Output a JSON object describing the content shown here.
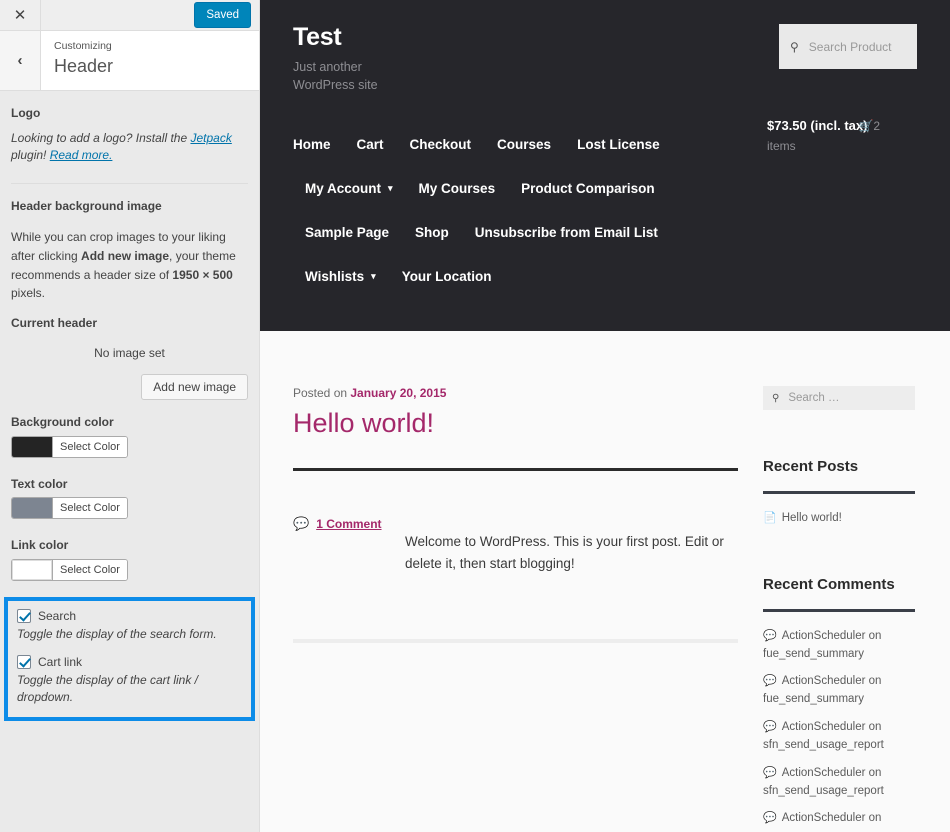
{
  "customizer": {
    "close_icon": "close-icon",
    "save_label": "Saved",
    "back_icon": "chevron-left-icon",
    "eyebrow": "Customizing",
    "title": "Header",
    "logo": {
      "label": "Logo",
      "desc_part1": "Looking to add a logo? Install the ",
      "link1": "Jetpack",
      "desc_part2": " plugin! ",
      "link2": "Read more."
    },
    "header_image": {
      "label": "Header background image",
      "desc_1": "While you can crop images to your liking after clicking ",
      "desc_bold_1": "Add new image",
      "desc_2": ", your theme recommends a header size of ",
      "desc_bold_2": "1950 × 500",
      "desc_3": " pixels.",
      "current_label": "Current header",
      "no_image": "No image set",
      "add_button": "Add new image"
    },
    "colors": [
      {
        "label": "Background color",
        "swatch": "#242424",
        "button": "Select Color"
      },
      {
        "label": "Text color",
        "swatch": "#7d8591",
        "button": "Select Color"
      },
      {
        "label": "Link color",
        "swatch": "#ffffff",
        "button": "Select Color"
      }
    ],
    "highlight_border_color": "#0d8ce8",
    "toggles": [
      {
        "label": "Search",
        "desc": "Toggle the display of the search form.",
        "checked": true
      },
      {
        "label": "Cart link",
        "desc": "Toggle the display of the cart link / dropdown.",
        "checked": true
      }
    ]
  },
  "preview": {
    "site_title": "Test",
    "tagline": "Just another WordPress site",
    "header_search_placeholder": "Search Product",
    "search_icon": "search-icon",
    "nav_rows": [
      [
        {
          "label": "Home",
          "has_dropdown": false
        },
        {
          "label": "Cart",
          "has_dropdown": false
        },
        {
          "label": "Checkout",
          "has_dropdown": false
        },
        {
          "label": "Courses",
          "has_dropdown": false
        },
        {
          "label": "Lost License",
          "has_dropdown": false
        }
      ],
      [
        {
          "label": "My Account",
          "has_dropdown": true
        },
        {
          "label": "My Courses",
          "has_dropdown": false
        },
        {
          "label": "Product Comparison",
          "has_dropdown": false
        }
      ],
      [
        {
          "label": "Sample Page",
          "has_dropdown": false
        },
        {
          "label": "Shop",
          "has_dropdown": false
        },
        {
          "label": "Unsubscribe from Email List",
          "has_dropdown": false
        }
      ],
      [
        {
          "label": "Wishlists",
          "has_dropdown": true
        },
        {
          "label": "Your Location",
          "has_dropdown": false
        }
      ]
    ],
    "cart": {
      "total": "$73.50 (incl. tax)",
      "icon": "cart-icon",
      "count": "2",
      "items_label": "items"
    },
    "post": {
      "posted_prefix": "Posted on ",
      "date": "January 20, 2015",
      "title": "Hello world!",
      "comment_icon": "comment-bubble-icon",
      "comment_link": "1 Comment",
      "excerpt": "Welcome to WordPress. This is your first post. Edit or delete it, then start blogging!"
    },
    "sidebar": {
      "search_placeholder": "Search …",
      "recent_posts_title": "Recent Posts",
      "recent_posts": [
        {
          "icon": "document-icon",
          "label": "Hello world!"
        }
      ],
      "recent_comments_title": "Recent Comments",
      "recent_comments": [
        {
          "icon": "comment-bubble-icon",
          "label": "ActionScheduler on fue_send_summary"
        },
        {
          "icon": "comment-bubble-icon",
          "label": "ActionScheduler on fue_send_summary"
        },
        {
          "icon": "comment-bubble-icon",
          "label": "ActionScheduler on sfn_send_usage_report"
        },
        {
          "icon": "comment-bubble-icon",
          "label": "ActionScheduler on sfn_send_usage_report"
        },
        {
          "icon": "comment-bubble-icon",
          "label": "ActionScheduler on"
        }
      ]
    }
  }
}
